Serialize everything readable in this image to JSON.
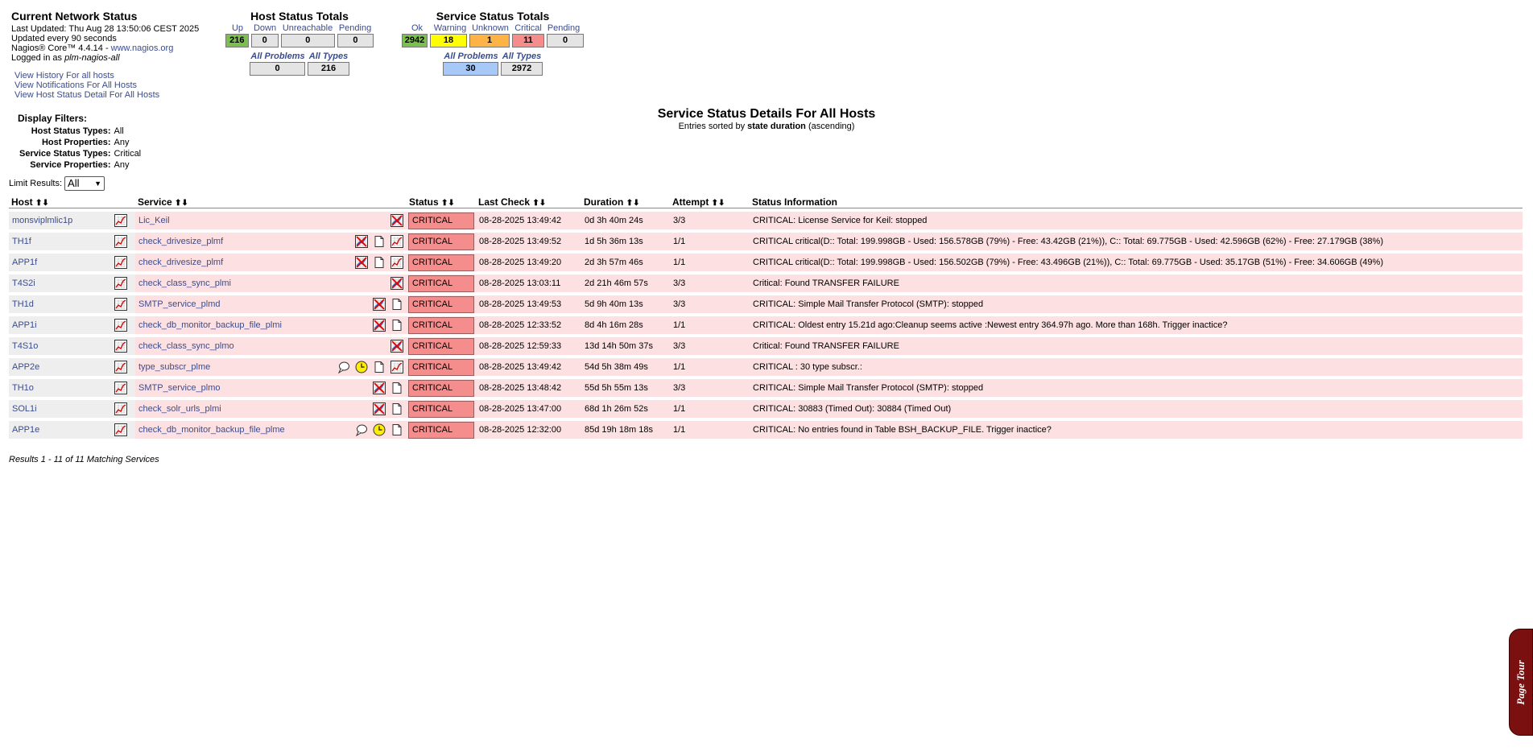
{
  "info": {
    "title": "Current Network Status",
    "last_updated": "Last Updated: Thu Aug 28 13:50:06 CEST 2025",
    "update_interval": "Updated every 90 seconds",
    "version_prefix": "Nagios® Core™ 4.4.14 - ",
    "version_link": "www.nagios.org",
    "logged_prefix": "Logged in as ",
    "logged_user": "plm-nagios-all"
  },
  "nav": {
    "history": "View History For all hosts",
    "notifications": "View Notifications For All Hosts",
    "host_detail": "View Host Status Detail For All Hosts"
  },
  "host_totals": {
    "title": "Host Status Totals",
    "labels": {
      "up": "Up",
      "down": "Down",
      "unreachable": "Unreachable",
      "pending": "Pending"
    },
    "values": {
      "up": "216",
      "down": "0",
      "unreachable": "0",
      "pending": "0"
    },
    "sub_labels": {
      "all_problems": "All Problems",
      "all_types": "All Types"
    },
    "sub_values": {
      "all_problems": "0",
      "all_types": "216"
    }
  },
  "service_totals": {
    "title": "Service Status Totals",
    "labels": {
      "ok": "Ok",
      "warning": "Warning",
      "unknown": "Unknown",
      "critical": "Critical",
      "pending": "Pending"
    },
    "values": {
      "ok": "2942",
      "warning": "18",
      "unknown": "1",
      "critical": "11",
      "pending": "0"
    },
    "sub_labels": {
      "all_problems": "All Problems",
      "all_types": "All Types"
    },
    "sub_values": {
      "all_problems": "30",
      "all_types": "2972"
    }
  },
  "colors": {
    "ok": "#7ac04e",
    "warning": "#ffff00",
    "unknown": "#ffb347",
    "critical": "#f58d8d",
    "problems": "#a8c8f8",
    "row_critical": "#fde0e2"
  },
  "filters": {
    "title": "Display Filters:",
    "rows": [
      {
        "label": "Host Status Types:",
        "value": "All"
      },
      {
        "label": "Host Properties:",
        "value": "Any"
      },
      {
        "label": "Service Status Types:",
        "value": "Critical"
      },
      {
        "label": "Service Properties:",
        "value": "Any"
      }
    ]
  },
  "limit": {
    "label": "Limit Results:",
    "value": "All"
  },
  "page": {
    "title": "Service Status Details For All Hosts",
    "sort_prefix": "Entries sorted by ",
    "sort_field": "state duration",
    "sort_suffix": " (ascending)"
  },
  "table": {
    "headers": {
      "host": "Host",
      "service": "Service",
      "status": "Status",
      "last_check": "Last Check",
      "duration": "Duration",
      "attempt": "Attempt",
      "info": "Status Information"
    },
    "rows": [
      {
        "host": "monsviplmlic1p",
        "service": "Lic_Keil",
        "status": "CRITICAL",
        "last_check": "08-28-2025 13:49:42",
        "duration": "0d 3h 40m 24s",
        "attempt": "3/3",
        "info": "CRITICAL: License Service for Keil: stopped",
        "icons": [
          "notif-disabled-icon"
        ]
      },
      {
        "host": "TH1f",
        "service": "check_drivesize_plmf",
        "status": "CRITICAL",
        "last_check": "08-28-2025 13:49:52",
        "duration": "1d 5h 36m 13s",
        "attempt": "1/1",
        "info": "CRITICAL critical(D:: Total: 199.998GB - Used: 156.578GB (79%) - Free: 43.42GB (21%)), C:: Total: 69.775GB - Used: 42.596GB (62%) - Free: 27.179GB (38%)",
        "icons": [
          "notif-disabled-icon",
          "document-icon",
          "graph-icon"
        ]
      },
      {
        "host": "APP1f",
        "service": "check_drivesize_plmf",
        "status": "CRITICAL",
        "last_check": "08-28-2025 13:49:20",
        "duration": "2d 3h 57m 46s",
        "attempt": "1/1",
        "info": "CRITICAL critical(D:: Total: 199.998GB - Used: 156.502GB (79%) - Free: 43.496GB (21%)), C:: Total: 69.775GB - Used: 35.17GB (51%) - Free: 34.606GB (49%)",
        "icons": [
          "notif-disabled-icon",
          "document-icon",
          "graph-icon"
        ]
      },
      {
        "host": "T4S2i",
        "service": "check_class_sync_plmi",
        "status": "CRITICAL",
        "last_check": "08-28-2025 13:03:11",
        "duration": "2d 21h 46m 57s",
        "attempt": "3/3",
        "info": "Critical: Found TRANSFER FAILURE",
        "icons": [
          "notif-disabled-icon"
        ]
      },
      {
        "host": "TH1d",
        "service": "SMTP_service_plmd",
        "status": "CRITICAL",
        "last_check": "08-28-2025 13:49:53",
        "duration": "5d 9h 40m 13s",
        "attempt": "3/3",
        "info": "CRITICAL: Simple Mail Transfer Protocol (SMTP): stopped",
        "icons": [
          "notif-disabled-icon",
          "document-icon"
        ]
      },
      {
        "host": "APP1i",
        "service": "check_db_monitor_backup_file_plmi",
        "status": "CRITICAL",
        "last_check": "08-28-2025 12:33:52",
        "duration": "8d 4h 16m 28s",
        "attempt": "1/1",
        "info": "CRITICAL: Oldest entry 15.21d ago:Cleanup seems active :Newest entry 364.97h ago. More than 168h. Trigger inactice?",
        "icons": [
          "notif-disabled-icon",
          "document-icon"
        ]
      },
      {
        "host": "T4S1o",
        "service": "check_class_sync_plmo",
        "status": "CRITICAL",
        "last_check": "08-28-2025 12:59:33",
        "duration": "13d 14h 50m 37s",
        "attempt": "3/3",
        "info": "Critical: Found TRANSFER FAILURE",
        "icons": [
          "notif-disabled-icon"
        ]
      },
      {
        "host": "APP2e",
        "service": "type_subscr_plme",
        "status": "CRITICAL",
        "last_check": "08-28-2025 13:49:42",
        "duration": "54d 5h 38m 49s",
        "attempt": "1/1",
        "info": "CRITICAL : 30 type subscr.:",
        "icons": [
          "comment-icon",
          "downtime-clock-icon",
          "document-icon",
          "graph-icon"
        ]
      },
      {
        "host": "TH1o",
        "service": "SMTP_service_plmo",
        "status": "CRITICAL",
        "last_check": "08-28-2025 13:48:42",
        "duration": "55d 5h 55m 13s",
        "attempt": "3/3",
        "info": "CRITICAL: Simple Mail Transfer Protocol (SMTP): stopped",
        "icons": [
          "notif-disabled-icon",
          "document-icon"
        ]
      },
      {
        "host": "SOL1i",
        "service": "check_solr_urls_plmi",
        "status": "CRITICAL",
        "last_check": "08-28-2025 13:47:00",
        "duration": "68d 1h 26m 52s",
        "attempt": "1/1",
        "info": "CRITICAL: 30883 (Timed Out): 30884 (Timed Out)",
        "icons": [
          "notif-disabled-icon",
          "document-icon"
        ]
      },
      {
        "host": "APP1e",
        "service": "check_db_monitor_backup_file_plme",
        "status": "CRITICAL",
        "last_check": "08-28-2025 12:32:00",
        "duration": "85d 19h 18m 18s",
        "attempt": "1/1",
        "info": "CRITICAL: No entries found in Table BSH_BACKUP_FILE. Trigger inactice?",
        "icons": [
          "comment-icon",
          "downtime-clock-icon",
          "document-icon"
        ]
      }
    ]
  },
  "results": "Results 1 - 11 of 11 Matching Services",
  "tour": "Page Tour"
}
